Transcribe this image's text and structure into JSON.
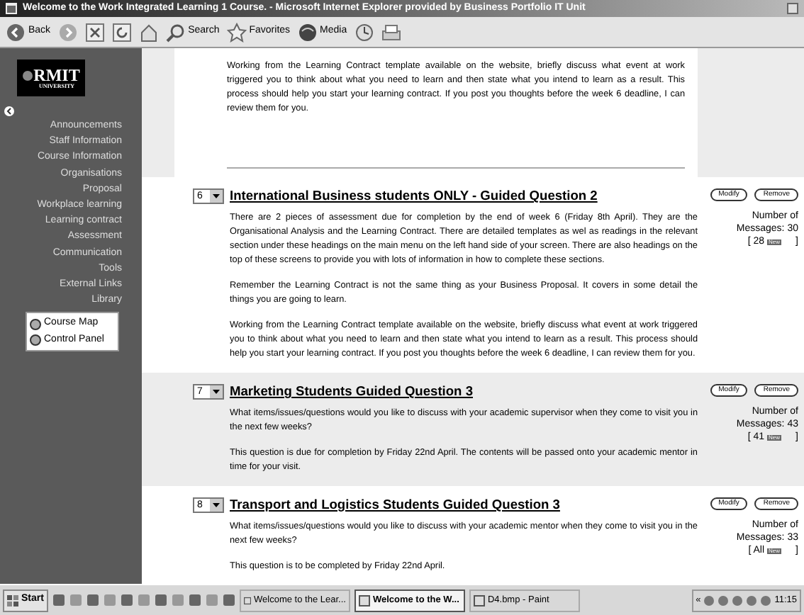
{
  "window": {
    "title": "Welcome to the Work Integrated Learning 1 Course. - Microsoft Internet Explorer provided by Business Portfolio IT Unit"
  },
  "toolbar": [
    {
      "kind": "back",
      "label": "Back"
    },
    {
      "kind": "forward"
    },
    {
      "kind": "stop"
    },
    {
      "kind": "refresh"
    },
    {
      "kind": "home"
    },
    {
      "kind": "search",
      "label": "Search"
    },
    {
      "kind": "favorites",
      "label": "Favorites"
    },
    {
      "kind": "media",
      "label": "Media"
    },
    {
      "kind": "history"
    },
    {
      "kind": "print"
    }
  ],
  "sidebar": {
    "logo": "RMIT",
    "logo_sub": "UNIVERSITY",
    "items": [
      "Announcements",
      "Staff Information",
      "Course Information",
      "Organisations",
      "Proposal",
      "Workplace learning",
      "Learning contract",
      "Assessment",
      "Communication",
      "Tools",
      "External Links",
      "Library"
    ],
    "tools": [
      "Course Map",
      "Control Panel"
    ]
  },
  "top_post": {
    "paragraph": "Working from the Learning Contract template available on the website, briefly discuss what event at work triggered you to think about what you need to learn and then state what you intend to learn as a result. This process should help you start your learning contract. If you post you thoughts before the week 6 deadline, I can review them for you."
  },
  "posts": [
    {
      "number": "6",
      "title": "International Business students ONLY - Guided Question 2",
      "shaded": false,
      "paragraphs": [
        "There are 2 pieces of assessment due for completion by the end of week 6 (Friday 8th April). They are the Organisational Analysis and the Learning Contract. There are detailed templates as wel as readings in the relevant section under these headings on the main menu on the left hand side of your screen. There are also headings on the top of these screens to provide you with lots of information in how to complete these sections.",
        "Remember the Learning Contract is not the same thing as your Business Proposal. It covers in some detail the things you are going to learn.",
        "Working from the Learning Contract template available on the website, briefly discuss what event at work triggered you to think about what you need to learn and then state what you intend to learn as a result. This process should help you start your learning contract. If you post you thoughts before the week 6 deadline, I can review them for you."
      ],
      "buttons": [
        "Modify",
        "Remove"
      ],
      "count_label": "Number of",
      "messages": "Messages: 30",
      "unread": "[ 28",
      "badge": "New",
      "unread_end": "]"
    },
    {
      "number": "7",
      "title": "Marketing Students Guided Question 3",
      "shaded": true,
      "paragraphs": [
        "What items/issues/questions would you like to discuss with your academic supervisor when they come to visit you in the next few weeks?",
        "This question is due for completion by Friday 22nd April. The contents will be passed onto your academic mentor in time for your visit."
      ],
      "buttons": [
        "Modify",
        "Remove"
      ],
      "count_label": "Number of",
      "messages": "Messages: 43",
      "unread": "[ 41",
      "badge": "New",
      "unread_end": "]"
    },
    {
      "number": "8",
      "title": "Transport and Logistics Students Guided Question 3",
      "shaded": false,
      "paragraphs": [
        "What items/issues/questions would you like to discuss with your academic mentor when they come to visit you in the next  few weeks?",
        "This question is to be completed by Friday 22nd April."
      ],
      "buttons": [
        "Modify",
        "Remove"
      ],
      "count_label": "Number of",
      "messages": "Messages: 33",
      "unread": "[ All",
      "badge": "New",
      "unread_end": "]"
    }
  ],
  "taskbar": {
    "start": "Start",
    "tasks": [
      {
        "label": "Welcome to the Lear...",
        "selected": false
      },
      {
        "label": "Welcome to the W...",
        "selected": true
      },
      {
        "label": "D4.bmp - Paint",
        "selected": false
      }
    ],
    "tray_arrow": "«",
    "clock": "11:15"
  }
}
